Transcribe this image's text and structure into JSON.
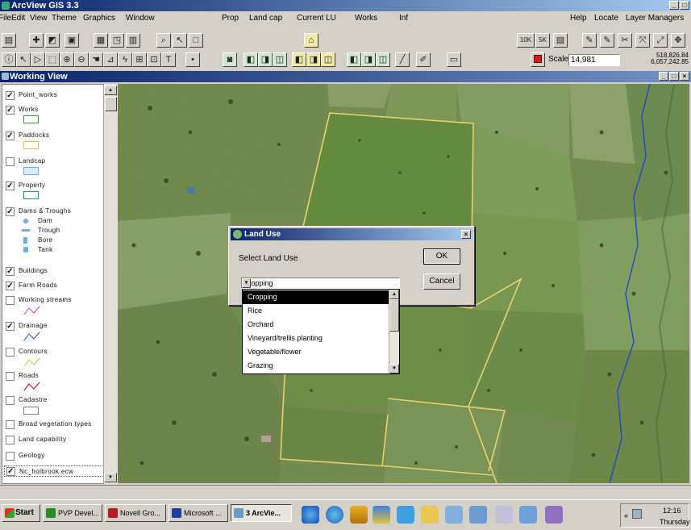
{
  "app": {
    "title": "ArcView GIS 3.3",
    "menus": [
      "File",
      "Edit",
      "View",
      "Theme",
      "Graphics",
      "Window",
      "Prop",
      "Land cap",
      "Current LU",
      "Works",
      "Inf",
      "Help",
      "Locate",
      "Layer Managers"
    ]
  },
  "toolbar": {
    "btn_10k": "10K",
    "btn_5k": "5K",
    "scale_label": "Scale 1:",
    "scale_value": "14,981",
    "coord_x": "518,826.84",
    "coord_y": "6,057,242.85"
  },
  "working_view": {
    "title": "Working View"
  },
  "layers": [
    {
      "name": "Point_works",
      "checked": true
    },
    {
      "name": "Works",
      "checked": true,
      "color": "#2e9e3e"
    },
    {
      "name": "Paddocks",
      "checked": true,
      "color": "#e0c040"
    },
    {
      "name": "Landcap",
      "checked": false,
      "color": "#6ab0e0"
    },
    {
      "name": "Property",
      "checked": true,
      "color": "#20a060"
    },
    {
      "name": "Dams & Troughs",
      "checked": true,
      "sub": [
        "Dam",
        "Trough",
        "Bore",
        "Tank"
      ]
    },
    {
      "name": "Buildings",
      "checked": true
    },
    {
      "name": "Farm Roads",
      "checked": true
    },
    {
      "name": "Working streams",
      "checked": false,
      "color": "#d040a0"
    },
    {
      "name": "Drainage",
      "checked": true,
      "color": "#3050c0"
    },
    {
      "name": "Contours",
      "checked": false,
      "color": "#e0c040"
    },
    {
      "name": "Roads",
      "checked": false,
      "color": "#c02020"
    },
    {
      "name": "Cadastre",
      "checked": false
    },
    {
      "name": "Broad vegetation types",
      "checked": false
    },
    {
      "name": "Land capability",
      "checked": false
    },
    {
      "name": "Geology",
      "checked": false
    },
    {
      "name": "Nc_holbrook.ecw",
      "checked": true
    }
  ],
  "dialog": {
    "title": "Land Use",
    "prompt": "Select Land Use",
    "ok": "OK",
    "cancel": "Cancel",
    "selected": "Cropping",
    "options": [
      "Cropping",
      "Rice",
      "Orchard",
      "Vineyard/trellis planting",
      "Vegetable/flower",
      "Grazing"
    ]
  },
  "taskbar": {
    "start": "Start",
    "tasks": [
      "PVP Devel...",
      "Novell Gro...",
      "Microsoft ...",
      "3 ArcVie..."
    ],
    "time": "12:16",
    "day": "Thursday"
  }
}
